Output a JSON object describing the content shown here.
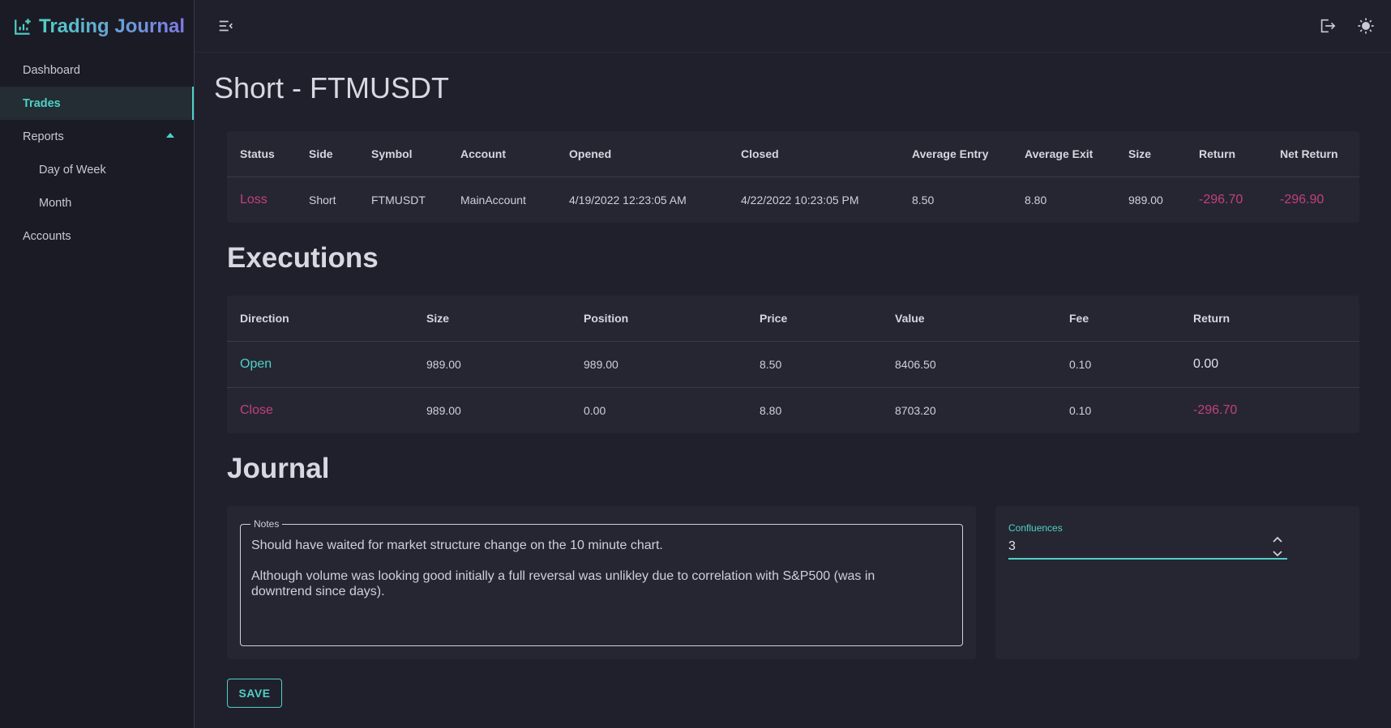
{
  "app": {
    "title": "Trading Journal",
    "brand_gradient": [
      "#4fd1c5",
      "#7f79e6"
    ]
  },
  "sidebar": {
    "items": [
      {
        "label": "Dashboard"
      },
      {
        "label": "Trades",
        "active": true
      },
      {
        "label": "Reports",
        "expanded": true
      },
      {
        "label": "Day of Week"
      },
      {
        "label": "Month"
      },
      {
        "label": "Accounts"
      }
    ]
  },
  "topbar": {
    "icons": [
      "menu-collapse-icon",
      "logout-icon",
      "theme-toggle-sun-icon"
    ]
  },
  "page": {
    "title": "Short - FTMUSDT"
  },
  "trade_table": {
    "headers": [
      "Status",
      "Side",
      "Symbol",
      "Account",
      "Opened",
      "Closed",
      "Average Entry",
      "Average Exit",
      "Size",
      "Return",
      "Net Return"
    ],
    "row": {
      "status": "Loss",
      "side": "Short",
      "symbol": "FTMUSDT",
      "account": "MainAccount",
      "opened": "4/19/2022 12:23:05 AM",
      "closed": "4/22/2022 10:23:05 PM",
      "avg_entry": "8.50",
      "avg_exit": "8.80",
      "size": "989.00",
      "return": "-296.70",
      "net_return": "-296.90"
    }
  },
  "executions": {
    "title": "Executions",
    "headers": [
      "Direction",
      "Size",
      "Position",
      "Price",
      "Value",
      "Fee",
      "Return"
    ],
    "rows": [
      {
        "direction": "Open",
        "size": "989.00",
        "position": "989.00",
        "price": "8.50",
        "value": "8406.50",
        "fee": "0.10",
        "return": "0.00"
      },
      {
        "direction": "Close",
        "size": "989.00",
        "position": "0.00",
        "price": "8.80",
        "value": "8703.20",
        "fee": "0.10",
        "return": "-296.70"
      }
    ]
  },
  "journal": {
    "title": "Journal",
    "notes_label": "Notes",
    "notes_value": "Should have waited for market structure change on the 10 minute chart.\n\nAlthough volume was looking good initially a full reversal was unlikley due to correlation with S&P500 (was in\ndowntrend since days).",
    "confluences_label": "Confluences",
    "confluences_value": "3",
    "save_label": "SAVE"
  },
  "colors": {
    "accent": "#4fd1c5",
    "loss": "#c2407a",
    "background": "#20202d",
    "sidebar": "#1b1b26",
    "card": "#262633"
  }
}
